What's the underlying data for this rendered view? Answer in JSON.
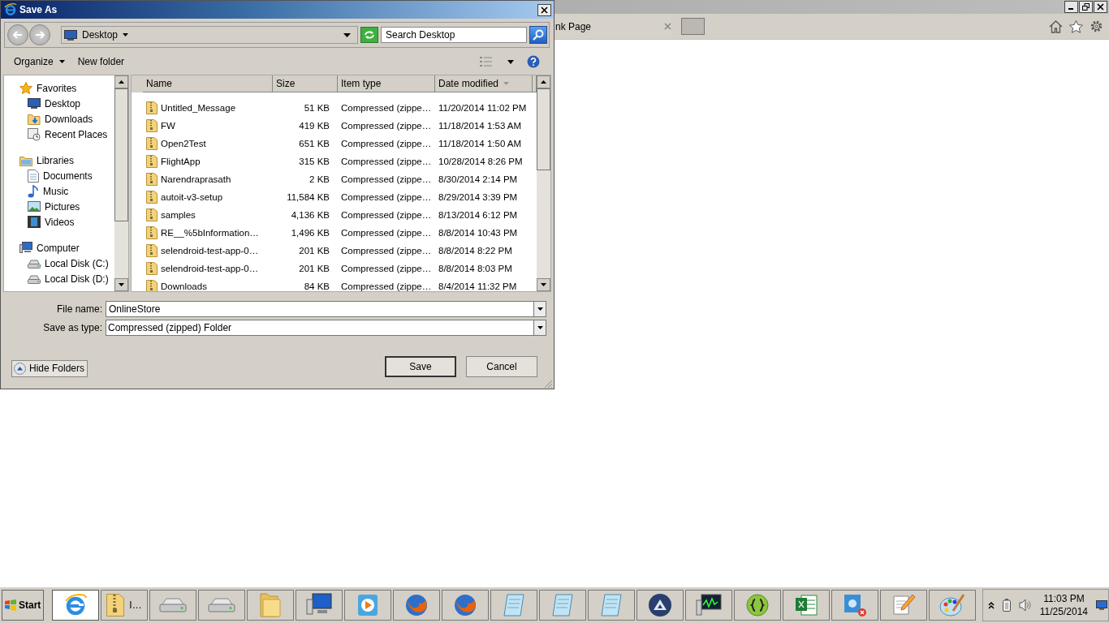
{
  "browser": {
    "tab": {
      "label": "nk Page"
    }
  },
  "dialog": {
    "title": "Save As",
    "address": {
      "location": "Desktop",
      "search_placeholder": "Search Desktop"
    },
    "toolbar": {
      "organize": "Organize",
      "new_folder": "New folder"
    },
    "navigation_pane": [
      {
        "label": "Favorites",
        "kind": "favorites",
        "children": [
          {
            "label": "Desktop",
            "kind": "desktop"
          },
          {
            "label": "Downloads",
            "kind": "downloads"
          },
          {
            "label": "Recent Places",
            "kind": "recent"
          }
        ]
      },
      {
        "label": "Libraries",
        "kind": "libraries",
        "children": [
          {
            "label": "Documents",
            "kind": "documents"
          },
          {
            "label": "Music",
            "kind": "music"
          },
          {
            "label": "Pictures",
            "kind": "pictures"
          },
          {
            "label": "Videos",
            "kind": "videos"
          }
        ]
      },
      {
        "label": "Computer",
        "kind": "computer",
        "children": [
          {
            "label": "Local Disk (C:)",
            "kind": "disk"
          },
          {
            "label": "Local Disk (D:)",
            "kind": "disk"
          }
        ]
      }
    ],
    "table": {
      "columns": [
        {
          "label": "Name",
          "sorted": false
        },
        {
          "label": "Size",
          "sorted": false
        },
        {
          "label": "Item type",
          "sorted": false
        },
        {
          "label": "Date modified",
          "sorted": true
        }
      ],
      "rows": [
        {
          "name": "Untitled_Message",
          "size": "51 KB",
          "type": "Compressed (zippe…",
          "date": "11/20/2014 11:02 PM"
        },
        {
          "name": "FW",
          "size": "419 KB",
          "type": "Compressed (zippe…",
          "date": "11/18/2014 1:53 AM"
        },
        {
          "name": "Open2Test",
          "size": "651 KB",
          "type": "Compressed (zippe…",
          "date": "11/18/2014 1:50 AM"
        },
        {
          "name": "FlightApp",
          "size": "315 KB",
          "type": "Compressed (zippe…",
          "date": "10/28/2014 8:26 PM"
        },
        {
          "name": "Narendraprasath",
          "size": "2 KB",
          "type": "Compressed (zippe…",
          "date": "8/30/2014 2:14 PM"
        },
        {
          "name": "autoit-v3-setup",
          "size": "11,584 KB",
          "type": "Compressed (zippe…",
          "date": "8/29/2014 3:39 PM"
        },
        {
          "name": "samples",
          "size": "4,136 KB",
          "type": "Compressed (zippe…",
          "date": "8/13/2014 6:12 PM"
        },
        {
          "name": "RE__%5bInformation…",
          "size": "1,496 KB",
          "type": "Compressed (zippe…",
          "date": "8/8/2014 10:43 PM"
        },
        {
          "name": "selendroid-test-app-0…",
          "size": "201 KB",
          "type": "Compressed (zippe…",
          "date": "8/8/2014 8:22 PM"
        },
        {
          "name": "selendroid-test-app-0…",
          "size": "201 KB",
          "type": "Compressed (zippe…",
          "date": "8/8/2014 8:03 PM"
        },
        {
          "name": "Downloads",
          "size": "84 KB",
          "type": "Compressed (zippe…",
          "date": "8/4/2014 11:32 PM"
        }
      ]
    },
    "file_name": {
      "label": "File name:",
      "value": "OnlineStore"
    },
    "save_as_type": {
      "label": "Save as type:",
      "value": "Compressed (zipped) Folder"
    },
    "hide_folders": "Hide Folders",
    "buttons": [
      {
        "label": "Save",
        "kind": "default"
      },
      {
        "label": "Cancel",
        "kind": "normal"
      }
    ]
  },
  "taskbar": {
    "start": "Start",
    "items": [
      {
        "kind": "ie",
        "selected": true
      },
      {
        "kind": "zip",
        "selected": false,
        "label": "I…"
      },
      {
        "kind": "drive",
        "selected": false
      },
      {
        "kind": "drive",
        "selected": false
      },
      {
        "kind": "folder",
        "selected": false
      },
      {
        "kind": "monitor",
        "selected": false
      },
      {
        "kind": "play",
        "selected": false
      },
      {
        "kind": "fox",
        "selected": false
      },
      {
        "kind": "fox",
        "selected": false
      },
      {
        "kind": "notepad",
        "selected": false
      },
      {
        "kind": "notepad",
        "selected": false
      },
      {
        "kind": "notepad",
        "selected": false
      },
      {
        "kind": "globe",
        "selected": false
      },
      {
        "kind": "chart",
        "selected": false
      },
      {
        "kind": "braces",
        "selected": false
      },
      {
        "kind": "sheet",
        "selected": false
      },
      {
        "kind": "chat",
        "selected": false
      },
      {
        "kind": "pencil",
        "selected": false
      },
      {
        "kind": "palette",
        "selected": false
      }
    ],
    "time": "11:03 PM",
    "date": "11/25/2014"
  }
}
